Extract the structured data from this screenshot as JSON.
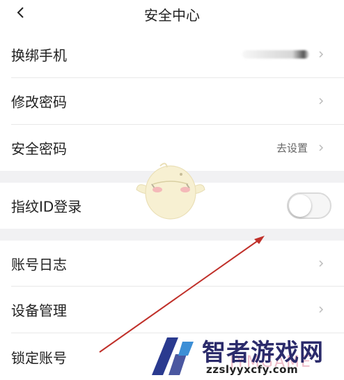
{
  "header": {
    "back_icon": "chevron-left-icon",
    "title": "安全中心"
  },
  "rows": [
    {
      "label": "换绑手机",
      "value": "",
      "trailing": "chevron-right-icon"
    },
    {
      "label": "修改密码",
      "value": "",
      "trailing": "chevron-right-icon"
    },
    {
      "label": "安全密码",
      "value": "去设置",
      "trailing": "chevron-right-icon"
    },
    {
      "label": "指纹ID登录",
      "toggle_on": false
    },
    {
      "label": "账号日志",
      "value": "",
      "trailing": "chevron-right-icon"
    },
    {
      "label": "设备管理",
      "value": "",
      "trailing": "chevron-right-icon"
    },
    {
      "label": "锁定账号",
      "value": "",
      "trailing": "chevron-right-icon"
    }
  ],
  "watermark": {
    "title": "智者游戏网",
    "url": "zzslyyxcfy.com",
    "overlay": "JYMGAME"
  },
  "colors": {
    "section_gap": "#f1f1f3",
    "arrow": "#c0302a",
    "watermark_title": "#2b2b6b",
    "watermark_logo": "#2a3a8f"
  }
}
